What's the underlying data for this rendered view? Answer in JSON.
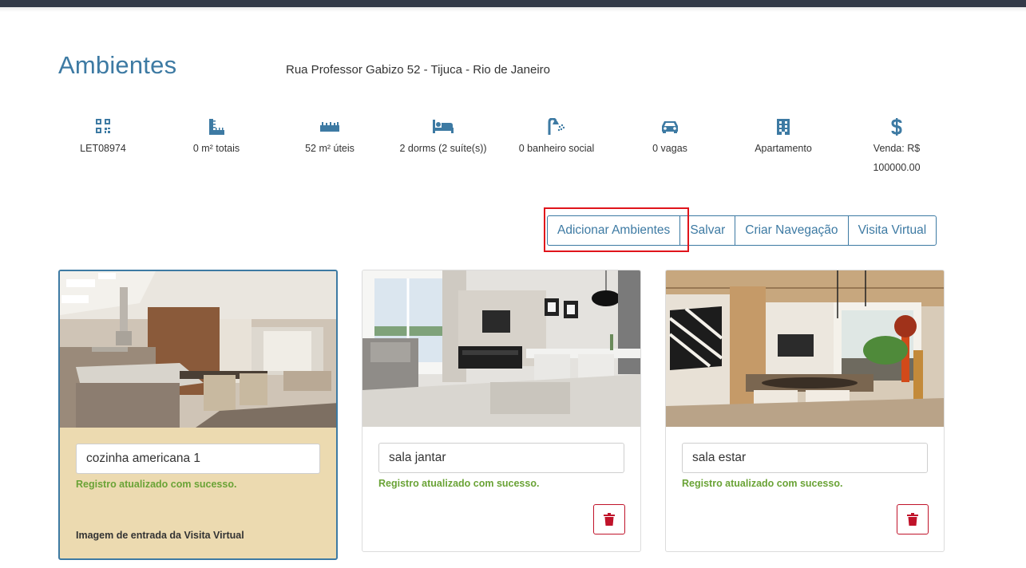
{
  "page": {
    "title": "Ambientes",
    "address": "Rua Professor Gabizo 52 - Tijuca - Rio de Janeiro"
  },
  "stats": [
    {
      "icon": "qrcode-icon",
      "text": "LET08974"
    },
    {
      "icon": "ruler-square-icon",
      "text": "0 m² totais"
    },
    {
      "icon": "ruler-icon",
      "text": "52 m² úteis"
    },
    {
      "icon": "bed-icon",
      "text": "2 dorms (2 suíte(s))"
    },
    {
      "icon": "shower-icon",
      "text": "0 banheiro social"
    },
    {
      "icon": "car-icon",
      "text": "0 vagas"
    },
    {
      "icon": "building-icon",
      "text": "Apartamento"
    },
    {
      "icon": "dollar-icon",
      "text": "Venda: R$ 100000.00"
    }
  ],
  "toolbar": {
    "add_label": "Adicionar Ambientes",
    "save_label": "Salvar",
    "nav_label": "Criar Navegação",
    "tour_label": "Visita Virtual"
  },
  "rooms": [
    {
      "name": "cozinha americana 1",
      "message": "Registro atualizado com sucesso.",
      "entry_label": "Imagem de entrada da Visita Virtual",
      "selected": true
    },
    {
      "name": "sala jantar",
      "message": "Registro atualizado com sucesso.",
      "selected": false
    },
    {
      "name": "sala estar",
      "message": "Registro atualizado com sucesso.",
      "selected": false
    }
  ],
  "colors": {
    "accent": "#3d7aa3",
    "topbar": "#333a48",
    "success": "#6aa336",
    "danger": "#c0132a",
    "selected_card": "#ecdab0",
    "highlight": "#e0141b"
  }
}
